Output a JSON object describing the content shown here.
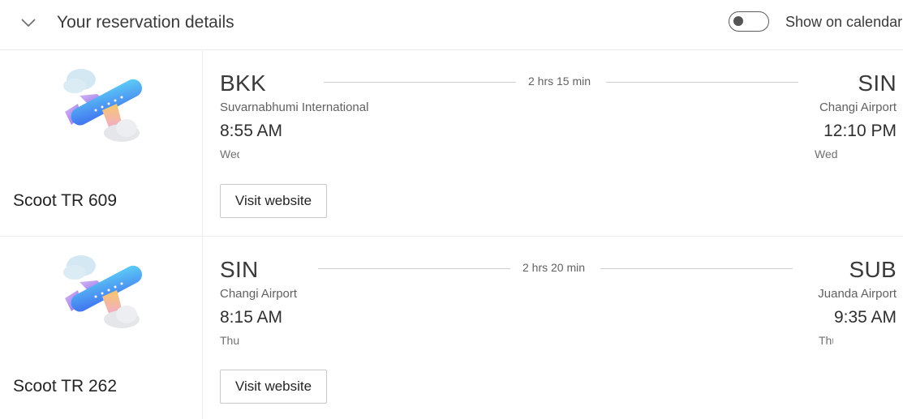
{
  "header": {
    "title": "Your reservation details",
    "calendar_toggle_label": "Show on calendar",
    "calendar_toggle_on": false
  },
  "flights": [
    {
      "carrier": "Scoot TR 609",
      "origin": {
        "code": "BKK",
        "airport": "Suvarnabhumi International",
        "time": "8:55 AM",
        "day": "Wed"
      },
      "destination": {
        "code": "SIN",
        "airport": "Changi Airport",
        "time": "12:10 PM",
        "day": "Wed"
      },
      "duration": "2 hrs 15 min",
      "visit_label": "Visit website"
    },
    {
      "carrier": "Scoot TR 262",
      "origin": {
        "code": "SIN",
        "airport": "Changi Airport",
        "time": "8:15 AM",
        "day": "Thu"
      },
      "destination": {
        "code": "SUB",
        "airport": "Juanda Airport",
        "time": "9:35 AM",
        "day": "Thu"
      },
      "duration": "2 hrs 20 min",
      "visit_label": "Visit website"
    }
  ],
  "icons": {
    "collapse": "chevron-down-icon",
    "flight": "airplane-icon"
  }
}
